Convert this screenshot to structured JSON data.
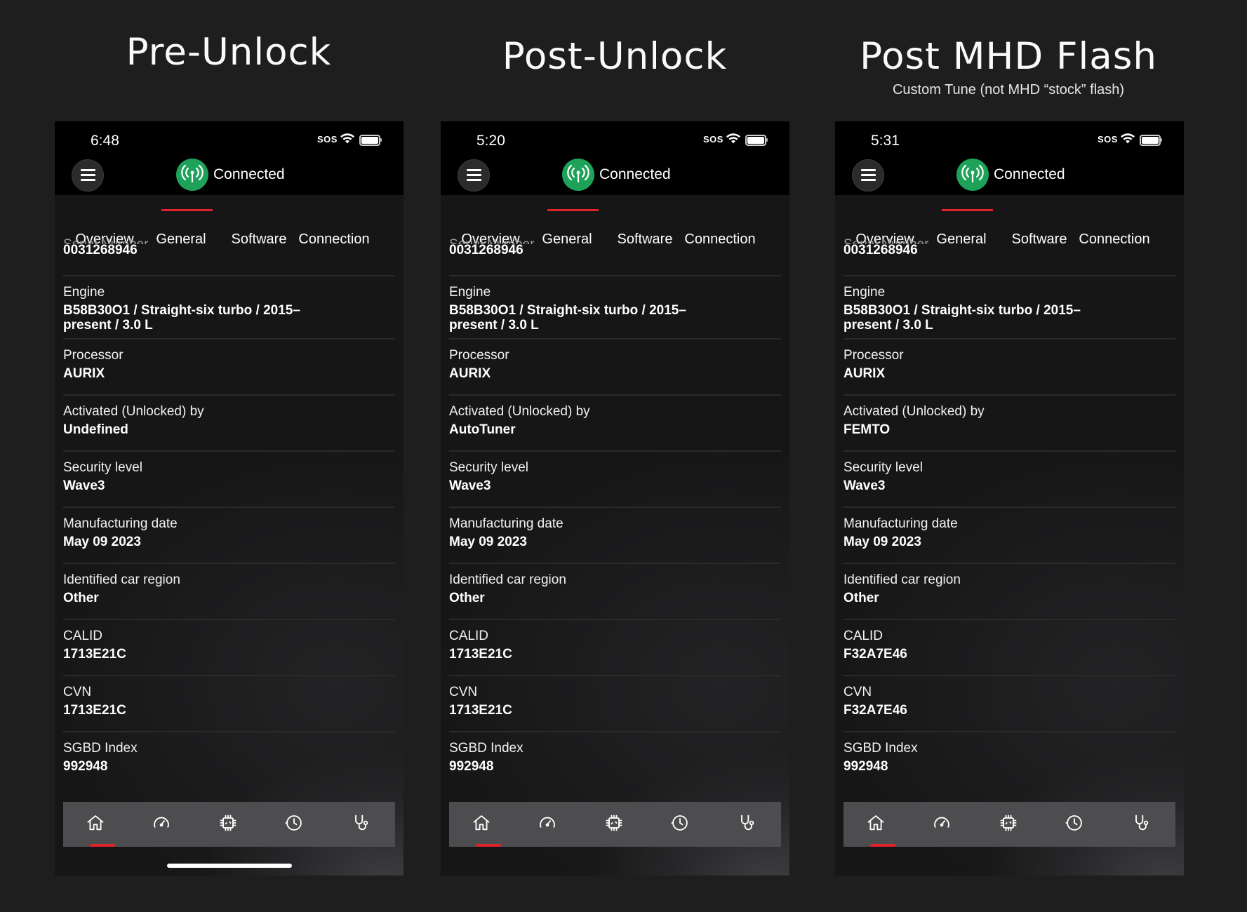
{
  "columns": [
    {
      "title": "Pre-Unlock",
      "subtitle": "",
      "time": "6:48",
      "sos": "SOS",
      "status": "Connected",
      "tabs": [
        "Overview",
        "General",
        "Software",
        "Connection"
      ],
      "active_tab": "General",
      "cut_label": "Serial Number",
      "serial": "0031268946",
      "fields": [
        {
          "label": "Engine",
          "value": "B58B30O1 / Straight-six turbo / 2015–present / 3.0 L"
        },
        {
          "label": "Processor",
          "value": "AURIX"
        },
        {
          "label": "Activated (Unlocked) by",
          "value": "Undefined"
        },
        {
          "label": "Security level",
          "value": "Wave3"
        },
        {
          "label": "Manufacturing date",
          "value": "May 09 2023"
        },
        {
          "label": "Identified car region",
          "value": "Other"
        },
        {
          "label": "CALID",
          "value": "1713E21C"
        },
        {
          "label": "CVN",
          "value": "1713E21C"
        },
        {
          "label": "SGBD Index",
          "value": "992948"
        }
      ],
      "bottom_nav": [
        "home-icon",
        "gauge-icon",
        "chip-icon",
        "history-icon",
        "diagnostics-icon"
      ],
      "show_home_indicator": true
    },
    {
      "title": "Post-Unlock",
      "subtitle": "",
      "time": "5:20",
      "sos": "SOS",
      "status": "Connected",
      "tabs": [
        "Overview",
        "General",
        "Software",
        "Connection"
      ],
      "active_tab": "General",
      "cut_label": "Serial Number",
      "serial": "0031268946",
      "fields": [
        {
          "label": "Engine",
          "value": "B58B30O1 / Straight-six turbo / 2015–present / 3.0 L"
        },
        {
          "label": "Processor",
          "value": "AURIX"
        },
        {
          "label": "Activated (Unlocked) by",
          "value": "AutoTuner"
        },
        {
          "label": "Security level",
          "value": "Wave3"
        },
        {
          "label": "Manufacturing date",
          "value": "May 09 2023"
        },
        {
          "label": "Identified car region",
          "value": "Other"
        },
        {
          "label": "CALID",
          "value": "1713E21C"
        },
        {
          "label": "CVN",
          "value": "1713E21C"
        },
        {
          "label": "SGBD Index",
          "value": "992948"
        }
      ],
      "bottom_nav": [
        "home-icon",
        "gauge-icon",
        "chip-icon",
        "history-icon",
        "diagnostics-icon"
      ],
      "show_home_indicator": false
    },
    {
      "title": "Post MHD Flash",
      "subtitle": "Custom Tune (not MHD “stock” flash)",
      "time": "5:31",
      "sos": "SOS",
      "status": "Connected",
      "tabs": [
        "Overview",
        "General",
        "Software",
        "Connection"
      ],
      "active_tab": "General",
      "cut_label": "Serial Number",
      "serial": "0031268946",
      "fields": [
        {
          "label": "Engine",
          "value": "B58B30O1 / Straight-six turbo / 2015–present / 3.0 L"
        },
        {
          "label": "Processor",
          "value": "AURIX"
        },
        {
          "label": "Activated (Unlocked) by",
          "value": "FEMTO"
        },
        {
          "label": "Security level",
          "value": "Wave3"
        },
        {
          "label": "Manufacturing date",
          "value": "May 09 2023"
        },
        {
          "label": "Identified car region",
          "value": "Other"
        },
        {
          "label": "CALID",
          "value": "F32A7E46"
        },
        {
          "label": "CVN",
          "value": "F32A7E46"
        },
        {
          "label": "SGBD Index",
          "value": "992948"
        }
      ],
      "bottom_nav": [
        "home-icon",
        "gauge-icon",
        "chip-icon",
        "history-icon",
        "diagnostics-icon"
      ],
      "show_home_indicator": false
    }
  ],
  "colors": {
    "background": "#1e1e1f",
    "accent": "#e0222c",
    "connected": "#1ea25a",
    "tabbar": "#4d4d4f"
  }
}
